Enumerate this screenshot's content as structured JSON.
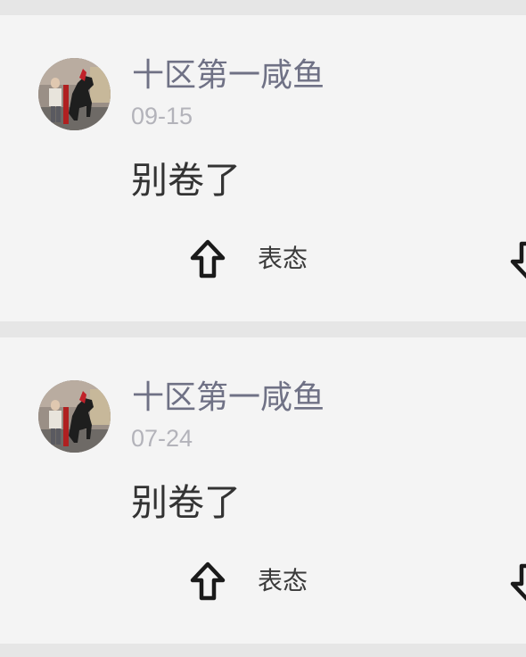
{
  "comments": [
    {
      "username": "十区第一咸鱼",
      "date": "09-15",
      "content": "别卷了",
      "react_label": "表态"
    },
    {
      "username": "十区第一咸鱼",
      "date": "07-24",
      "content": "别卷了",
      "react_label": "表态"
    }
  ],
  "icons": {
    "upvote": "arrow-up-outline-icon",
    "downvote": "arrow-down-outline-icon"
  },
  "colors": {
    "username": "#6f7185",
    "date": "#b3b3ba",
    "content": "#333333",
    "card_background": "#f4f4f4",
    "divider": "#e6e6e6"
  }
}
